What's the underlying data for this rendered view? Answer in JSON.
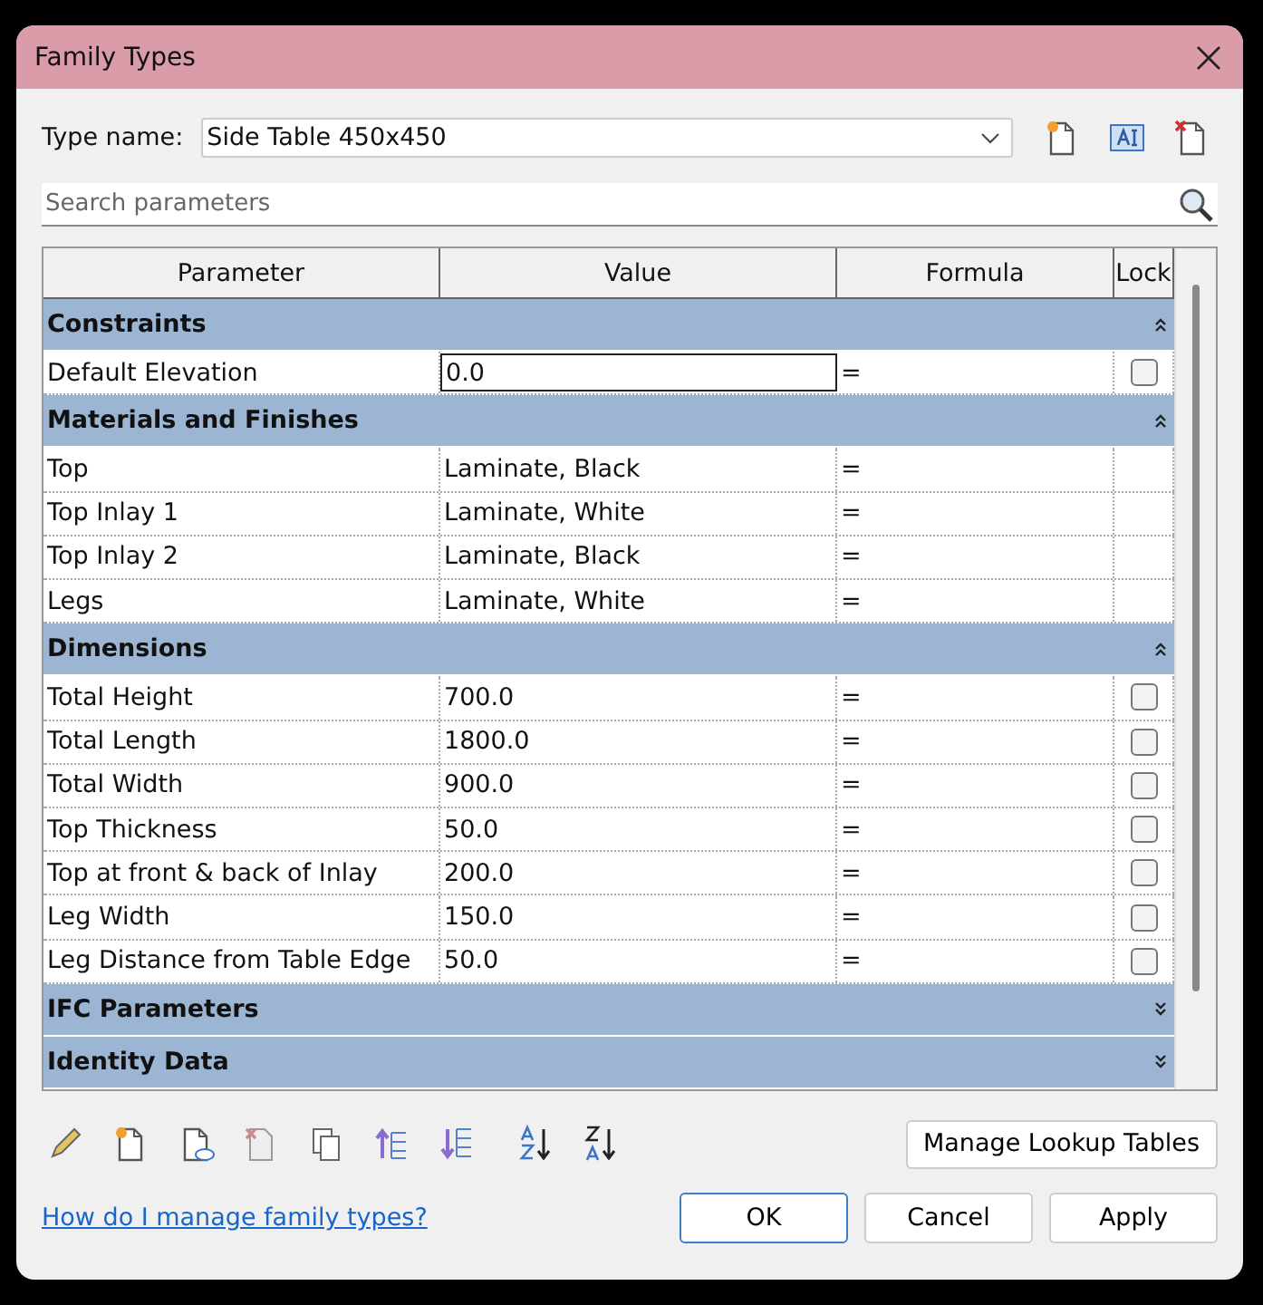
{
  "window": {
    "title": "Family Types"
  },
  "type_name": {
    "label": "Type name:",
    "value": "Side Table 450x450"
  },
  "search": {
    "placeholder": "Search parameters"
  },
  "table": {
    "columns": [
      "Parameter",
      "Value",
      "Formula",
      "Lock"
    ],
    "groups": [
      {
        "name": "Constraints",
        "expanded": true,
        "rows": [
          {
            "parameter": "Default Elevation",
            "value": "0.0",
            "formula": "=",
            "kind": "lockable",
            "locked": false,
            "selected": true
          }
        ]
      },
      {
        "name": "Materials and Finishes",
        "expanded": true,
        "rows": [
          {
            "parameter": "Top",
            "value": "Laminate, Black",
            "formula": "=",
            "kind": "plain",
            "selected": false
          },
          {
            "parameter": "Top Inlay 1",
            "value": "Laminate, White",
            "formula": "=",
            "kind": "plain",
            "selected": false
          },
          {
            "parameter": "Top Inlay 2",
            "value": "Laminate, Black",
            "formula": "=",
            "kind": "plain",
            "selected": false
          },
          {
            "parameter": "Legs",
            "value": "Laminate, White",
            "formula": "=",
            "kind": "plain",
            "selected": false
          }
        ]
      },
      {
        "name": "Dimensions",
        "expanded": true,
        "rows": [
          {
            "parameter": "Total Height",
            "value": "700.0",
            "formula": "=",
            "kind": "lockable",
            "locked": false,
            "selected": false
          },
          {
            "parameter": "Total Length",
            "value": "1800.0",
            "formula": "=",
            "kind": "lockable",
            "locked": false,
            "selected": false
          },
          {
            "parameter": "Total Width",
            "value": "900.0",
            "formula": "=",
            "kind": "lockable",
            "locked": false,
            "selected": false
          },
          {
            "parameter": "Top Thickness",
            "value": "50.0",
            "formula": "=",
            "kind": "lockable",
            "locked": false,
            "selected": false
          },
          {
            "parameter": "Top at front & back of Inlay",
            "value": "200.0",
            "formula": "=",
            "kind": "lockable",
            "locked": false,
            "selected": false
          },
          {
            "parameter": "Leg Width",
            "value": "150.0",
            "formula": "=",
            "kind": "lockable",
            "locked": false,
            "selected": false
          },
          {
            "parameter": "Leg Distance from Table Edge",
            "value": "50.0",
            "formula": "=",
            "kind": "lockable",
            "locked": false,
            "selected": false
          }
        ]
      },
      {
        "name": "IFC Parameters",
        "expanded": false
      },
      {
        "name": "Identity Data",
        "expanded": false
      }
    ]
  },
  "manage_button": "Manage Lookup Tables",
  "help_link": "How do I manage family types?",
  "buttons": [
    {
      "label": "OK",
      "selected": true
    },
    {
      "label": "Cancel",
      "selected": false
    },
    {
      "label": "Apply",
      "selected": false
    }
  ]
}
